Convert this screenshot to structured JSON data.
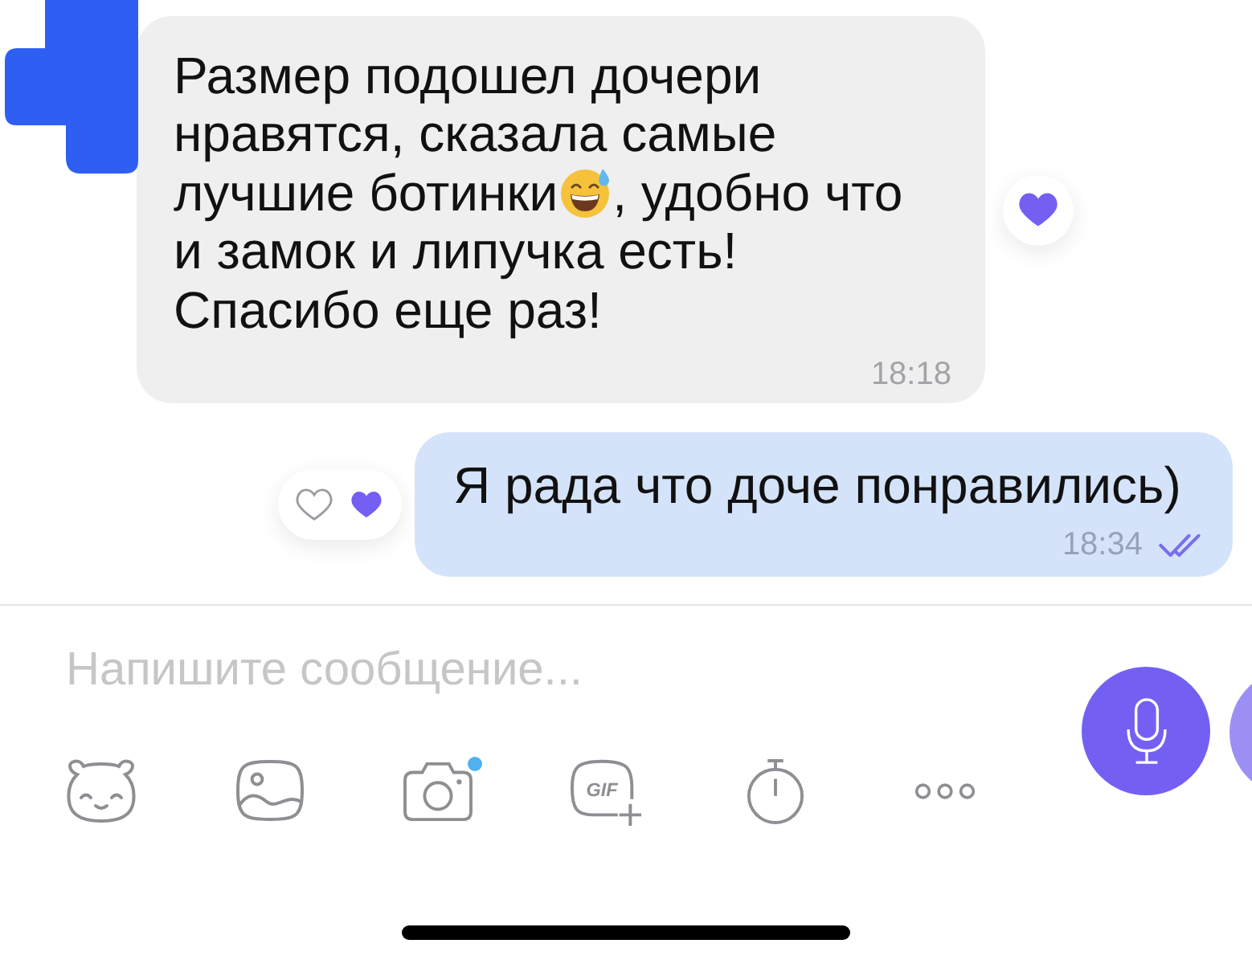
{
  "messages": [
    {
      "kind": "incoming",
      "rows": [
        [
          {
            "kind": "text",
            "text": "Размер подошел дочери\nнравятся, сказала самые"
          }
        ],
        [
          {
            "kind": "text",
            "text": "лучшие ботинки"
          },
          {
            "kind": "emoji"
          },
          {
            "kind": "text",
            "text": ", удобно что"
          }
        ],
        [
          {
            "kind": "text",
            "text": "и замок и липучка есть!\nСпасибо еще раз!"
          }
        ]
      ],
      "time": "18:18",
      "liked": true
    },
    {
      "kind": "outgoing",
      "rows": [
        [
          {
            "kind": "text",
            "text": "Я рада что доче понравились)"
          }
        ]
      ],
      "time": "18:34",
      "liked": false,
      "liked_by_contact": true,
      "read": true
    }
  ],
  "composer": {
    "placeholder": "Напишите сообщение..."
  },
  "toolbar": [
    {
      "kind": "sticker",
      "badge": false
    },
    {
      "kind": "gallery",
      "badge": false
    },
    {
      "kind": "camera",
      "badge": true
    },
    {
      "kind": "gif",
      "label": "GIF",
      "badge": false
    },
    {
      "kind": "timer",
      "badge": false
    },
    {
      "kind": "more",
      "badge": false
    }
  ]
}
